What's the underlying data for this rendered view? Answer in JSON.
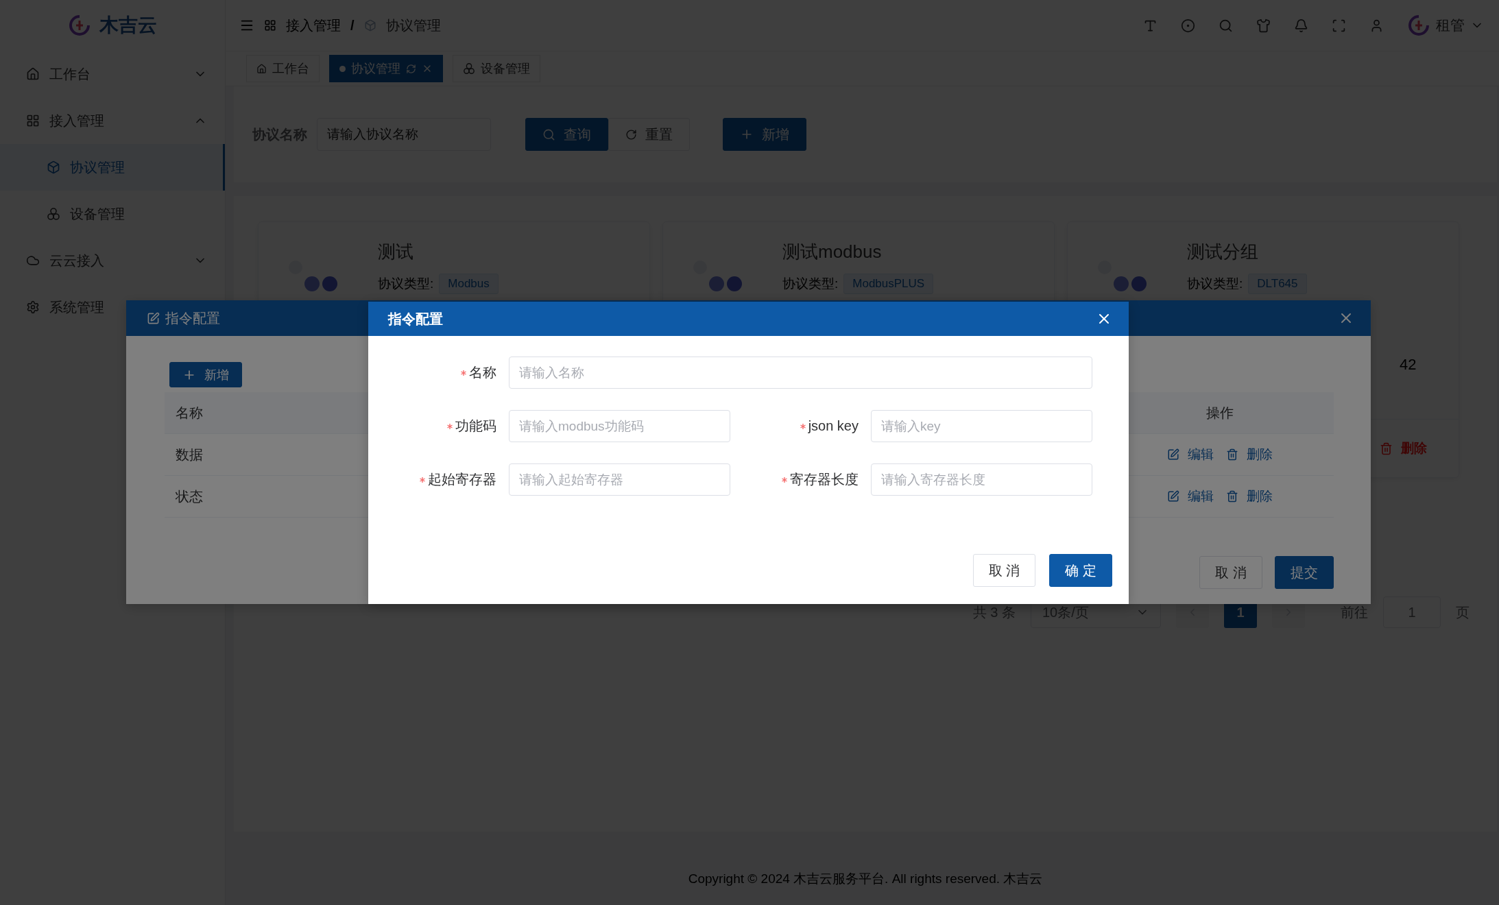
{
  "sidebar": {
    "logo": "木吉云",
    "items": [
      {
        "label": "工作台",
        "expanded": false
      },
      {
        "label": "接入管理",
        "expanded": true,
        "children": [
          {
            "label": "协议管理",
            "selected": true
          },
          {
            "label": "设备管理",
            "selected": false
          }
        ]
      },
      {
        "label": "云云接入",
        "expanded": false
      },
      {
        "label": "系统管理"
      }
    ]
  },
  "header": {
    "breadcrumb": [
      "接入管理",
      "协议管理"
    ],
    "separator": "/",
    "user": "租管"
  },
  "tabs": [
    {
      "label": "工作台",
      "selected": false
    },
    {
      "label": "协议管理",
      "selected": true
    },
    {
      "label": "设备管理",
      "selected": false
    }
  ],
  "search": {
    "label": "协议名称",
    "placeholder": "请输入协议名称",
    "query_button": "查询",
    "reset_button": "重置",
    "add_button": "新增"
  },
  "cards": [
    {
      "title": "测试",
      "type_label": "协议类型:",
      "type": "Modbus"
    },
    {
      "title": "测试modbus",
      "type_label": "协议类型:",
      "type": "ModbusPLUS"
    },
    {
      "title": "测试分组",
      "type_label": "协议类型:",
      "type": "DLT645",
      "detail": "42",
      "delete": "删除"
    }
  ],
  "pagination": {
    "total": "共 3 条",
    "page_size": "10条/页",
    "pages": [
      {
        "label": "1",
        "selected": true
      }
    ],
    "goto_label": "前往",
    "goto_value": "1",
    "goto_suffix": "页"
  },
  "footer": "Copyright © 2024 木吉云服务平台. All rights reserved. 木吉云",
  "config_dialog": {
    "title": "指令配置",
    "add_button": "新增",
    "columns": [
      "名称",
      "操作"
    ],
    "rows": [
      {
        "name": "数据",
        "edit": "编辑",
        "delete": "删除"
      },
      {
        "name": "状态",
        "edit": "编辑",
        "delete": "删除"
      }
    ],
    "cancel": "取 消",
    "submit": "提交"
  },
  "form_dialog": {
    "title": "指令配置",
    "rows": [
      [
        {
          "label": "名称",
          "placeholder": "请输入名称",
          "required": true
        }
      ],
      [
        {
          "label": "功能码",
          "placeholder": "请输入modbus功能码",
          "required": true
        },
        {
          "label": "json key",
          "placeholder": "请输入key",
          "required": true
        }
      ],
      [
        {
          "label": "起始寄存器",
          "placeholder": "请输入起始寄存器",
          "required": true
        },
        {
          "label": "寄存器长度",
          "placeholder": "请输入寄存器长度",
          "required": true
        }
      ]
    ],
    "cancel": "取 消",
    "confirm": "确 定"
  }
}
